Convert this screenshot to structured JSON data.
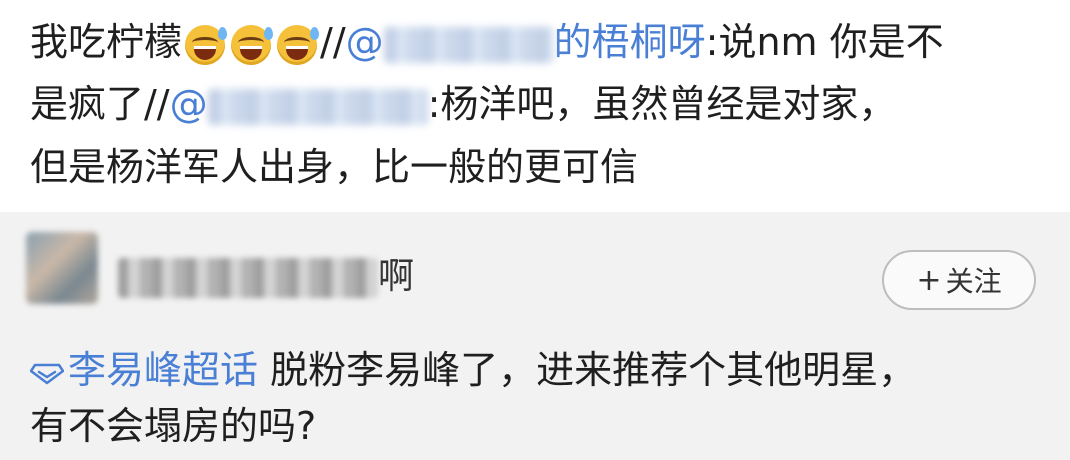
{
  "repost": {
    "line1_text": "我吃柠檬",
    "line1_slashes": "//",
    "mention1_at": "@",
    "mention1_visible": "的梧桐呀",
    "line1_after": ":说nm 你是不",
    "line2_text": "是疯了//",
    "mention2_at": "@",
    "line2_after": ":杨洋吧，虽然曾经是对家，",
    "line3_text": "但是杨洋军人出身，比一般的更可信",
    "emoji_name": "grinning-sweat-emoji"
  },
  "author": {
    "name_suffix": "啊"
  },
  "follow_button": {
    "label": "关注",
    "plus": "+"
  },
  "post": {
    "topic": "李易峰超话",
    "text_line1": " 脱粉李易峰了，进来推荐个其他明星，",
    "text_line2": "有不会塌房的吗?"
  },
  "colors": {
    "mention": "#4a7fd6",
    "background_top": "#ffffff",
    "background_bottom": "#f2f2f2"
  }
}
